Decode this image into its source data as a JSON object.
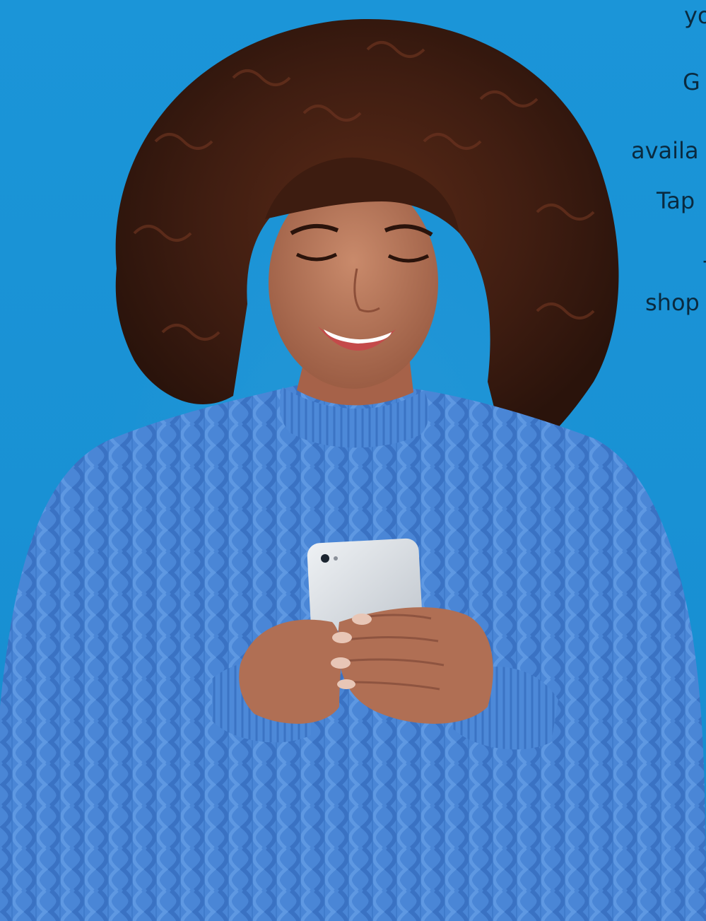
{
  "background_color": "#1a92d6",
  "photo": {
    "subject": "smiling woman with curly hair in a blue cable-knit sweater looking at a smartphone",
    "icon": "woman-with-phone-photo"
  },
  "text_fragments": [
    "yo",
    "G",
    "availa",
    "Tap",
    "-",
    "shop"
  ],
  "colors": {
    "text": "#0a2a3f",
    "sweater": "#4a86d6",
    "hair": "#3a1d12",
    "skin": "#b9755a",
    "phone": "#d9dde2"
  }
}
